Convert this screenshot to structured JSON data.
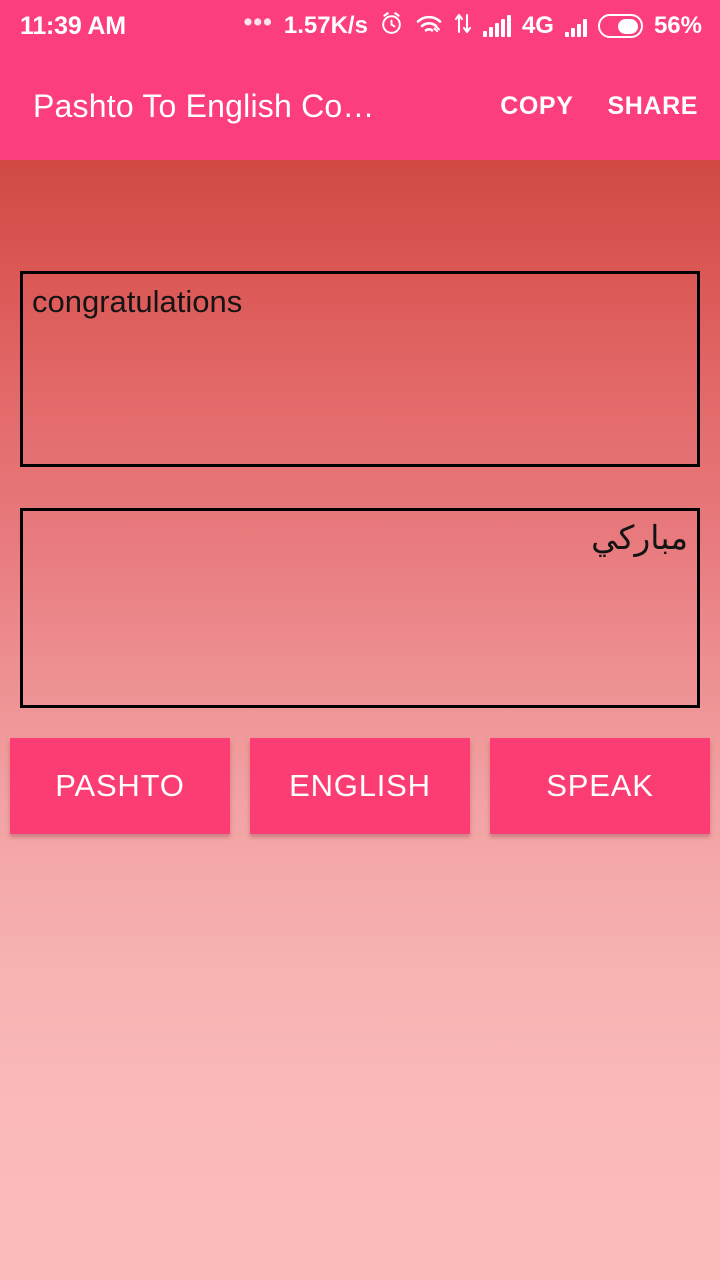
{
  "status_bar": {
    "clock": "11:39 AM",
    "overflow_dots": "•••",
    "network_speed": "1.57K/s",
    "alarm_icon": "alarm-clock-icon",
    "wifi_icon": "wifi-icon",
    "data_transfer_icon": "data-transfer-arrows-icon",
    "signal_icon_1": "cellular-signal-icon",
    "network_type": "4G",
    "signal_icon_2": "cellular-signal-secondary-icon",
    "battery_icon": "battery-icon",
    "battery_level": "56%",
    "battery_fill_percent": 56,
    "background_color": "#fc3d7e",
    "foreground_color": "#ffffff"
  },
  "app_bar": {
    "title": "Pashto To English Co…",
    "copy_label": "COPY",
    "share_label": "SHARE",
    "background_color": "#fc3d7e",
    "text_color": "#ffffff"
  },
  "content": {
    "english_field": {
      "value": "congratulations",
      "placeholder": ""
    },
    "pashto_field": {
      "value": "مبارکي",
      "placeholder": ""
    },
    "border_color": "#000000"
  },
  "buttons": {
    "pashto_label": "PASHTO",
    "english_label": "ENGLISH",
    "speak_label": "SPEAK",
    "background_color": "#fc3d74",
    "text_color": "#ffffff"
  },
  "background": {
    "gradient_top_color": "#c7332d",
    "gradient_bottom_color": "#fcbcbc"
  }
}
